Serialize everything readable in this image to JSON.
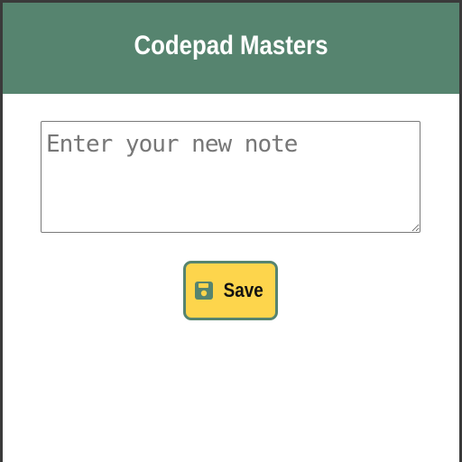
{
  "header": {
    "title": "Codepad Masters"
  },
  "note": {
    "placeholder": "Enter your new note",
    "value": ""
  },
  "actions": {
    "save_label": "Save",
    "save_icon": "floppy-disk-icon"
  },
  "colors": {
    "header_bg": "#56846f",
    "button_bg": "#fdd54c",
    "button_border": "#56846f"
  }
}
